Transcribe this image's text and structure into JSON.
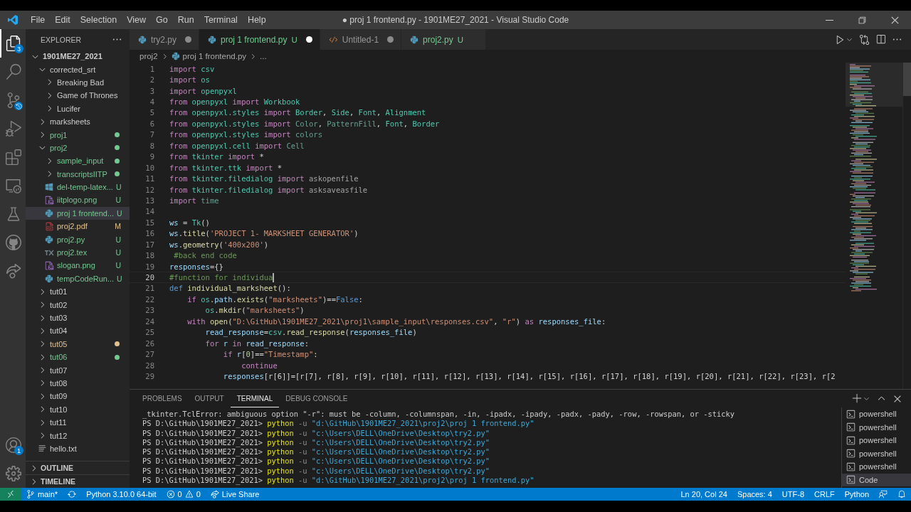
{
  "title_bar": {
    "menu": [
      "File",
      "Edit",
      "Selection",
      "View",
      "Go",
      "Run",
      "Terminal",
      "Help"
    ],
    "title": "● proj 1 frontend.py - 1901ME27_2021 - Visual Studio Code"
  },
  "activity_bar": {
    "items": [
      {
        "kind": "explorer",
        "selected": true,
        "badge": "3"
      },
      {
        "kind": "search",
        "selected": false
      },
      {
        "kind": "source_control",
        "selected": false
      },
      {
        "kind": "run",
        "selected": false
      },
      {
        "kind": "extensions",
        "selected": false
      },
      {
        "kind": "remote",
        "selected": false
      },
      {
        "kind": "testing",
        "selected": false
      },
      {
        "kind": "github",
        "selected": false
      },
      {
        "kind": "liveshare",
        "selected": false
      }
    ],
    "bottom": [
      {
        "kind": "account",
        "selected": false,
        "badge": "1"
      },
      {
        "kind": "settings",
        "selected": false
      }
    ]
  },
  "sidebar": {
    "title": "EXPLORER",
    "tree": {
      "label": "1901ME27_2021",
      "kind": "folder",
      "expanded": true,
      "dot": false,
      "selected": false,
      "children": [
        {
          "label": "corrected_srt",
          "kind": "folder",
          "expanded": true,
          "dot": false,
          "selected": false,
          "children": [
            {
              "label": "Breaking Bad",
              "kind": "folder",
              "expanded": false,
              "dot": false,
              "selected": false
            },
            {
              "label": "Game of Thrones",
              "kind": "folder",
              "expanded": false,
              "dot": false,
              "selected": false
            },
            {
              "label": "Lucifer",
              "kind": "folder",
              "expanded": false,
              "dot": false,
              "selected": false
            }
          ]
        },
        {
          "label": "marksheets",
          "kind": "folder",
          "expanded": false,
          "dot": false,
          "selected": false
        },
        {
          "label": "proj1",
          "kind": "folder",
          "expanded": false,
          "dot": true,
          "selected": false,
          "color": "#73c991"
        },
        {
          "label": "proj2",
          "kind": "folder",
          "expanded": true,
          "dot": true,
          "selected": false,
          "color": "#73c991",
          "children": [
            {
              "label": "sample_input",
              "kind": "folder",
              "expanded": false,
              "dot": true,
              "selected": false,
              "color": "#73c991"
            },
            {
              "label": "transcriptsIITP",
              "kind": "folder",
              "expanded": false,
              "dot": true,
              "selected": false,
              "color": "#73c991"
            },
            {
              "label": "del-temp-latex...",
              "kind": "windows",
              "badge": "U",
              "dot": false,
              "selected": false,
              "color": "#73c991"
            },
            {
              "label": "iitplogo.png",
              "kind": "image",
              "badge": "U",
              "dot": false,
              "selected": false,
              "color": "#73c991"
            },
            {
              "label": "proj 1 frontend...",
              "kind": "python",
              "badge": "U",
              "dot": false,
              "selected": true,
              "color": "#73c991"
            },
            {
              "label": "proj2.pdf",
              "kind": "pdf",
              "badge": "M",
              "dot": false,
              "selected": false,
              "color": "#e2c08d"
            },
            {
              "label": "proj2.py",
              "kind": "python",
              "badge": "U",
              "dot": false,
              "selected": false,
              "color": "#73c991"
            },
            {
              "label": "proj2.tex",
              "kind": "tex",
              "badge": "U",
              "dot": false,
              "selected": false,
              "color": "#73c991"
            },
            {
              "label": "slogan.png",
              "kind": "image",
              "badge": "U",
              "dot": false,
              "selected": false,
              "color": "#73c991"
            },
            {
              "label": "tempCodeRun...",
              "kind": "python",
              "badge": "U",
              "dot": false,
              "selected": false,
              "color": "#73c991"
            }
          ]
        },
        {
          "label": "tut01",
          "kind": "folder",
          "expanded": false,
          "dot": false,
          "selected": false
        },
        {
          "label": "tut02",
          "kind": "folder",
          "expanded": false,
          "dot": false,
          "selected": false
        },
        {
          "label": "tut03",
          "kind": "folder",
          "expanded": false,
          "dot": false,
          "selected": false
        },
        {
          "label": "tut04",
          "kind": "folder",
          "expanded": false,
          "dot": false,
          "selected": false
        },
        {
          "label": "tut05",
          "kind": "folder",
          "expanded": false,
          "dot": true,
          "selected": false,
          "color": "#e2c08d"
        },
        {
          "label": "tut06",
          "kind": "folder",
          "expanded": false,
          "dot": true,
          "selected": false,
          "color": "#73c991"
        },
        {
          "label": "tut07",
          "kind": "folder",
          "expanded": false,
          "dot": false,
          "selected": false
        },
        {
          "label": "tut08",
          "kind": "folder",
          "expanded": false,
          "dot": false,
          "selected": false
        },
        {
          "label": "tut09",
          "kind": "folder",
          "expanded": false,
          "dot": false,
          "selected": false
        },
        {
          "label": "tut10",
          "kind": "folder",
          "expanded": false,
          "dot": false,
          "selected": false
        },
        {
          "label": "tut11",
          "kind": "folder",
          "expanded": false,
          "dot": false,
          "selected": false
        },
        {
          "label": "tut12",
          "kind": "folder",
          "expanded": false,
          "dot": false,
          "selected": false
        },
        {
          "label": "hello.txt",
          "kind": "text",
          "dot": false,
          "selected": false
        }
      ]
    },
    "sections": [
      {
        "label": "OUTLINE",
        "expanded": false
      },
      {
        "label": "TIMELINE",
        "expanded": false
      }
    ]
  },
  "tabs": [
    {
      "label": "try2.py",
      "kind": "python",
      "dirty": true,
      "selected": false
    },
    {
      "label": "proj 1 frontend.py",
      "kind": "python",
      "badge": "U",
      "dirty": true,
      "selected": true,
      "color": "#73c991"
    },
    {
      "label": "Untitled-1",
      "kind": "code",
      "dirty": true,
      "selected": false
    },
    {
      "label": "proj2.py",
      "kind": "python",
      "badge": "U",
      "dirty": false,
      "selected": false,
      "color": "#73c991"
    }
  ],
  "breadcrumb": [
    {
      "label": "proj2",
      "kind": "folder"
    },
    {
      "label": "proj 1 frontend.py",
      "kind": "python"
    },
    {
      "label": "...",
      "kind": "symbol"
    }
  ],
  "editor": {
    "lines": [
      {
        "number": "1",
        "current": false,
        "tokens": [
          {
            "kind": "kw",
            "text": "import "
          },
          {
            "kind": "type",
            "text": "csv"
          }
        ]
      },
      {
        "number": "2",
        "current": false,
        "tokens": [
          {
            "kind": "kw",
            "text": "import "
          },
          {
            "kind": "type",
            "text": "os"
          }
        ]
      },
      {
        "number": "3",
        "current": false,
        "tokens": [
          {
            "kind": "kw",
            "text": "import "
          },
          {
            "kind": "type",
            "text": "openpyxl"
          }
        ]
      },
      {
        "number": "4",
        "current": false,
        "tokens": [
          {
            "kind": "kw",
            "text": "from "
          },
          {
            "kind": "type",
            "text": "openpyxl "
          },
          {
            "kind": "kw",
            "text": "import "
          },
          {
            "kind": "type",
            "text": "Workbook"
          }
        ]
      },
      {
        "number": "5",
        "current": false,
        "tokens": [
          {
            "kind": "kw",
            "text": "from "
          },
          {
            "kind": "type",
            "text": "openpyxl.styles "
          },
          {
            "kind": "kw",
            "text": "import "
          },
          {
            "kind": "type",
            "text": "Border"
          },
          {
            "kind": "plain",
            "text": ", "
          },
          {
            "kind": "type",
            "text": "Side"
          },
          {
            "kind": "plain",
            "text": ", "
          },
          {
            "kind": "type",
            "text": "Font"
          },
          {
            "kind": "plain",
            "text": ", "
          },
          {
            "kind": "type",
            "text": "Alignment"
          }
        ]
      },
      {
        "number": "6",
        "current": false,
        "tokens": [
          {
            "kind": "kw",
            "text": "from "
          },
          {
            "kind": "type",
            "text": "openpyxl.styles "
          },
          {
            "kind": "kw",
            "text": "import "
          },
          {
            "kind": "dim",
            "text": "Color"
          },
          {
            "kind": "plain",
            "text": ", "
          },
          {
            "kind": "dim",
            "text": "PatternFill"
          },
          {
            "kind": "plain",
            "text": ", "
          },
          {
            "kind": "type",
            "text": "Font"
          },
          {
            "kind": "plain",
            "text": ", "
          },
          {
            "kind": "type",
            "text": "Border"
          }
        ]
      },
      {
        "number": "7",
        "current": false,
        "tokens": [
          {
            "kind": "kw",
            "text": "from "
          },
          {
            "kind": "type",
            "text": "openpyxl.styles "
          },
          {
            "kind": "kw",
            "text": "import "
          },
          {
            "kind": "dim",
            "text": "colors"
          }
        ]
      },
      {
        "number": "8",
        "current": false,
        "tokens": [
          {
            "kind": "kw",
            "text": "from "
          },
          {
            "kind": "type",
            "text": "openpyxl.cell "
          },
          {
            "kind": "kw",
            "text": "import "
          },
          {
            "kind": "dim",
            "text": "Cell"
          }
        ]
      },
      {
        "number": "9",
        "current": false,
        "tokens": [
          {
            "kind": "kw",
            "text": "from "
          },
          {
            "kind": "type",
            "text": "tkinter "
          },
          {
            "kind": "kw",
            "text": "import "
          },
          {
            "kind": "plain",
            "text": "*"
          }
        ]
      },
      {
        "number": "10",
        "current": false,
        "tokens": [
          {
            "kind": "kw",
            "text": "from "
          },
          {
            "kind": "type",
            "text": "tkinter.ttk "
          },
          {
            "kind": "kw",
            "text": "import "
          },
          {
            "kind": "plain",
            "text": "*"
          }
        ]
      },
      {
        "number": "11",
        "current": false,
        "tokens": [
          {
            "kind": "kw",
            "text": "from "
          },
          {
            "kind": "type",
            "text": "tkinter.filedialog "
          },
          {
            "kind": "kw",
            "text": "import "
          },
          {
            "kind": "dimvar",
            "text": "askopenfile"
          }
        ]
      },
      {
        "number": "12",
        "current": false,
        "tokens": [
          {
            "kind": "kw",
            "text": "from "
          },
          {
            "kind": "type",
            "text": "tkinter.filedialog "
          },
          {
            "kind": "kw",
            "text": "import "
          },
          {
            "kind": "dimvar",
            "text": "asksaveasfile"
          }
        ]
      },
      {
        "number": "13",
        "current": false,
        "tokens": [
          {
            "kind": "kw",
            "text": "import "
          },
          {
            "kind": "dim",
            "text": "time"
          }
        ]
      },
      {
        "number": "14",
        "current": false
      },
      {
        "number": "15",
        "current": false,
        "tokens": [
          {
            "kind": "var",
            "text": "ws"
          },
          {
            "kind": "plain",
            "text": " = "
          },
          {
            "kind": "type",
            "text": "Tk"
          },
          {
            "kind": "plain",
            "text": "()"
          }
        ]
      },
      {
        "number": "16",
        "current": false,
        "tokens": [
          {
            "kind": "var",
            "text": "ws"
          },
          {
            "kind": "plain",
            "text": "."
          },
          {
            "kind": "fn",
            "text": "title"
          },
          {
            "kind": "plain",
            "text": "("
          },
          {
            "kind": "str",
            "text": "'PROJECT 1- MARKSHEET GENERATOR'"
          },
          {
            "kind": "plain",
            "text": ")"
          }
        ]
      },
      {
        "number": "17",
        "current": false,
        "tokens": [
          {
            "kind": "var",
            "text": "ws"
          },
          {
            "kind": "plain",
            "text": "."
          },
          {
            "kind": "fn",
            "text": "geometry"
          },
          {
            "kind": "plain",
            "text": "("
          },
          {
            "kind": "str",
            "text": "'400x200'"
          },
          {
            "kind": "plain",
            "text": ")"
          }
        ]
      },
      {
        "number": "18",
        "current": false,
        "tokens": [
          {
            "kind": "cmt",
            "text": " #back end code"
          }
        ]
      },
      {
        "number": "19",
        "current": false,
        "tokens": [
          {
            "kind": "var",
            "text": "responses"
          },
          {
            "kind": "plain",
            "text": "={}"
          }
        ]
      },
      {
        "number": "20",
        "current": true,
        "tokens": [
          {
            "kind": "cmt",
            "text": "#function for individua"
          }
        ]
      },
      {
        "number": "21",
        "current": false,
        "tokens": [
          {
            "kind": "const",
            "text": "def "
          },
          {
            "kind": "fn",
            "text": "individual_marksheet"
          },
          {
            "kind": "plain",
            "text": "():"
          }
        ]
      },
      {
        "number": "22",
        "current": false,
        "tokens": [
          {
            "kind": "kw",
            "text": "    if "
          },
          {
            "kind": "type",
            "text": "os"
          },
          {
            "kind": "plain",
            "text": "."
          },
          {
            "kind": "var",
            "text": "path"
          },
          {
            "kind": "plain",
            "text": "."
          },
          {
            "kind": "fn",
            "text": "exists"
          },
          {
            "kind": "plain",
            "text": "("
          },
          {
            "kind": "str",
            "text": "\"marksheets\""
          },
          {
            "kind": "plain",
            "text": ")=="
          },
          {
            "kind": "const",
            "text": "False"
          },
          {
            "kind": "plain",
            "text": ":"
          }
        ]
      },
      {
        "number": "23",
        "current": false,
        "tokens": [
          {
            "kind": "type",
            "text": "        os"
          },
          {
            "kind": "plain",
            "text": "."
          },
          {
            "kind": "fn",
            "text": "mkdir"
          },
          {
            "kind": "plain",
            "text": "("
          },
          {
            "kind": "str",
            "text": "\"marksheets\""
          },
          {
            "kind": "plain",
            "text": ")"
          }
        ]
      },
      {
        "number": "24",
        "current": false,
        "tokens": [
          {
            "kind": "kw",
            "text": "    with "
          },
          {
            "kind": "fn",
            "text": "open"
          },
          {
            "kind": "plain",
            "text": "("
          },
          {
            "kind": "str",
            "text": "\"D:\\GitHub\\1901ME27_2021\\proj1\\sample_input\\responses.csv\""
          },
          {
            "kind": "plain",
            "text": ", "
          },
          {
            "kind": "str",
            "text": "\"r\""
          },
          {
            "kind": "plain",
            "text": ") "
          },
          {
            "kind": "kw",
            "text": "as "
          },
          {
            "kind": "var",
            "text": "responses_file"
          },
          {
            "kind": "plain",
            "text": ":"
          }
        ]
      },
      {
        "number": "25",
        "current": false,
        "tokens": [
          {
            "kind": "var",
            "text": "        read_response"
          },
          {
            "kind": "plain",
            "text": "="
          },
          {
            "kind": "type",
            "text": "csv"
          },
          {
            "kind": "plain",
            "text": "."
          },
          {
            "kind": "fn",
            "text": "read_response"
          },
          {
            "kind": "plain",
            "text": "("
          },
          {
            "kind": "var",
            "text": "responses_file"
          },
          {
            "kind": "plain",
            "text": ")"
          }
        ]
      },
      {
        "number": "26",
        "current": false,
        "tokens": [
          {
            "kind": "kw",
            "text": "        for "
          },
          {
            "kind": "var",
            "text": "r "
          },
          {
            "kind": "kw",
            "text": "in "
          },
          {
            "kind": "var",
            "text": "read_response"
          },
          {
            "kind": "plain",
            "text": ":"
          }
        ]
      },
      {
        "number": "27",
        "current": false,
        "tokens": [
          {
            "kind": "kw",
            "text": "            if "
          },
          {
            "kind": "var",
            "text": "r"
          },
          {
            "kind": "plain",
            "text": "["
          },
          {
            "kind": "num",
            "text": "0"
          },
          {
            "kind": "plain",
            "text": "]=="
          },
          {
            "kind": "str",
            "text": "\"Timestamp\""
          },
          {
            "kind": "plain",
            "text": ":"
          }
        ]
      },
      {
        "number": "28",
        "current": false,
        "tokens": [
          {
            "kind": "kw",
            "text": "                continue"
          }
        ]
      },
      {
        "number": "29",
        "current": false,
        "tokens": [
          {
            "kind": "var",
            "text": "            responses"
          },
          {
            "kind": "plain",
            "text": "[r[6]]=[r[7], r[8], r[9], r[10], r[11], r[12], r[13], r[14], r[15], r[16], r[17], r[18], r[19], r[20], r[21], r[22], r[23], r[2"
          }
        ]
      }
    ]
  },
  "panel": {
    "tabs": [
      {
        "label": "PROBLEMS",
        "selected": false
      },
      {
        "label": "OUTPUT",
        "selected": false
      },
      {
        "label": "TERMINAL",
        "selected": true
      },
      {
        "label": "DEBUG CONSOLE",
        "selected": false
      }
    ],
    "terminal_lines": [
      {
        "tokens": [
          {
            "kind": "plain",
            "text": "_tkinter.TclError: ambiguous option \"-r\": must be -column, -columnspan, -in, -ipadx, -ipady, -padx, -pady, -row, -rowspan, or -sticky"
          }
        ]
      },
      {
        "tokens": [
          {
            "kind": "plain",
            "text": "PS D:\\GitHub\\1901ME27_2021> "
          },
          {
            "kind": "cmd",
            "text": "python "
          },
          {
            "kind": "flag",
            "text": "-u "
          },
          {
            "kind": "str",
            "text": "\"d:\\GitHub\\1901ME27_2021\\proj2\\proj 1 frontend.py\""
          }
        ]
      },
      {
        "tokens": [
          {
            "kind": "plain",
            "text": "PS D:\\GitHub\\1901ME27_2021> "
          },
          {
            "kind": "cmd",
            "text": "python "
          },
          {
            "kind": "flag",
            "text": "-u "
          },
          {
            "kind": "str",
            "text": "\"c:\\Users\\DELL\\OneDrive\\Desktop\\try2.py\""
          }
        ]
      },
      {
        "tokens": [
          {
            "kind": "plain",
            "text": "PS D:\\GitHub\\1901ME27_2021> "
          },
          {
            "kind": "cmd",
            "text": "python "
          },
          {
            "kind": "flag",
            "text": "-u "
          },
          {
            "kind": "str",
            "text": "\"c:\\Users\\DELL\\OneDrive\\Desktop\\try2.py\""
          }
        ]
      },
      {
        "tokens": [
          {
            "kind": "plain",
            "text": "PS D:\\GitHub\\1901ME27_2021> "
          },
          {
            "kind": "cmd",
            "text": "python "
          },
          {
            "kind": "flag",
            "text": "-u "
          },
          {
            "kind": "str",
            "text": "\"c:\\Users\\DELL\\OneDrive\\Desktop\\try2.py\""
          }
        ]
      },
      {
        "tokens": [
          {
            "kind": "plain",
            "text": "PS D:\\GitHub\\1901ME27_2021> "
          },
          {
            "kind": "cmd",
            "text": "python "
          },
          {
            "kind": "flag",
            "text": "-u "
          },
          {
            "kind": "str",
            "text": "\"c:\\Users\\DELL\\OneDrive\\Desktop\\try2.py\""
          }
        ]
      },
      {
        "tokens": [
          {
            "kind": "plain",
            "text": "PS D:\\GitHub\\1901ME27_2021> "
          },
          {
            "kind": "cmd",
            "text": "python "
          },
          {
            "kind": "flag",
            "text": "-u "
          },
          {
            "kind": "str",
            "text": "\"c:\\Users\\DELL\\OneDrive\\Desktop\\try2.py\""
          }
        ]
      },
      {
        "tokens": [
          {
            "kind": "plain",
            "text": "PS D:\\GitHub\\1901ME27_2021> "
          },
          {
            "kind": "cmd",
            "text": "python "
          },
          {
            "kind": "flag",
            "text": "-u "
          },
          {
            "kind": "str",
            "text": "\"d:\\GitHub\\1901ME27_2021\\proj2\\proj 1 frontend.py\""
          }
        ]
      }
    ],
    "terminals": [
      {
        "label": "powershell",
        "selected": false
      },
      {
        "label": "powershell",
        "selected": false
      },
      {
        "label": "powershell",
        "selected": false
      },
      {
        "label": "powershell",
        "selected": false
      },
      {
        "label": "powershell",
        "selected": false
      },
      {
        "label": "Code",
        "selected": true
      }
    ]
  },
  "status_bar": {
    "left": [
      {
        "kind": "remote"
      },
      {
        "kind": "branch",
        "label": "main*"
      },
      {
        "kind": "sync"
      },
      {
        "kind": "text",
        "label": "Python 3.10.0 64-bit"
      },
      {
        "kind": "problems",
        "errors": "0",
        "warnings": "0"
      },
      {
        "kind": "liveshare",
        "label": "Live Share"
      }
    ],
    "right": [
      {
        "kind": "text",
        "label": "Ln 20, Col 24"
      },
      {
        "kind": "text",
        "label": "Spaces: 4"
      },
      {
        "kind": "text",
        "label": "UTF-8"
      },
      {
        "kind": "text",
        "label": "CRLF"
      },
      {
        "kind": "text",
        "label": "Python"
      },
      {
        "kind": "feedback"
      },
      {
        "kind": "bell"
      }
    ]
  }
}
